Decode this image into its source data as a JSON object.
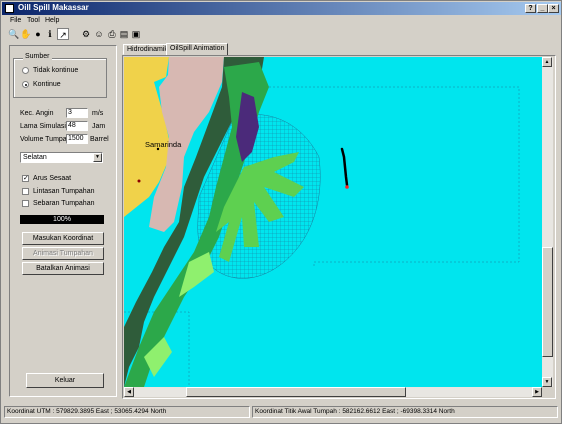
{
  "window": {
    "title": "Oill Spill Makassar",
    "controls": {
      "help": "?",
      "minimize": "_",
      "maximize": "□",
      "close": "×"
    }
  },
  "menu": [
    "File",
    "Tool",
    "Help"
  ],
  "toolbar": [
    "zoom-in-icon",
    "hand-pan-icon",
    "globe-icon",
    "info-icon",
    "pointer-icon",
    "run-icon",
    "person-icon",
    "print-icon",
    "chart-icon",
    "layers-icon"
  ],
  "panel": {
    "sumber": {
      "title": "Sumber",
      "options": [
        "Tidak kontinue",
        "Kontinue"
      ],
      "selected": "Kontinue"
    },
    "fields": [
      {
        "label": "Kec. Angin",
        "value": "3",
        "unit": "m/s"
      },
      {
        "label": "Lama Simulasi",
        "value": "48",
        "unit": "Jam"
      },
      {
        "label": "Volume Tumpah",
        "value": "1500",
        "unit": "Barrel"
      }
    ],
    "direction": "Selatan",
    "checks": [
      {
        "label": "Arus Sesaat",
        "checked": true
      },
      {
        "label": "Lintasan Tumpahan",
        "checked": false
      },
      {
        "label": "Sebaran Tumpahan",
        "checked": false
      }
    ],
    "progress": {
      "value": 1.0,
      "label": "100%"
    },
    "buttons": {
      "masukan": "Masukan Koordinat",
      "animasi": "Animasi Tumpahan",
      "batalkan": "Batalkan Animasi",
      "keluar": "Keluar"
    }
  },
  "tabs": [
    {
      "label": "Hidrodinamika",
      "active": false
    },
    {
      "label": "OilSpill Animation",
      "active": true
    }
  ],
  "map": {
    "city_label": "Samarinda",
    "colors": {
      "sea": "#00e5ee",
      "land_yellow": "#f0d24a",
      "land_pink": "#d7b8b2",
      "dark_green": "#2f5c3a",
      "green": "#2ca84a",
      "light_green": "#5ed050",
      "lime": "#8ff06e",
      "purple": "#4b2a7a",
      "grid": "#1a7fa0"
    }
  },
  "status": {
    "utm": "Koordinat UTM  :  579829.3895 East  ;  53065.4294 North",
    "spill": "Koordinat Titik Awal Tumpah  :  582162.6612 East  ;  -69398.3314 North"
  }
}
